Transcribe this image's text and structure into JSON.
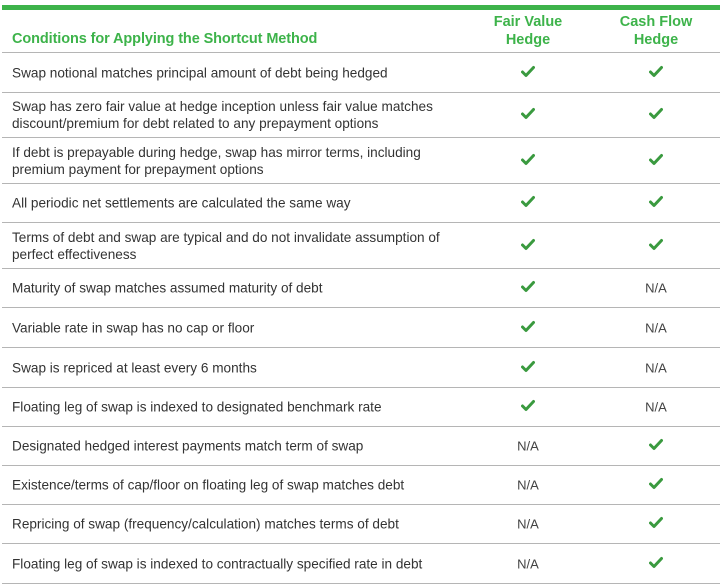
{
  "header": {
    "condition_label": "Conditions for Applying the Shortcut Method",
    "fair_value_label_line1": "Fair Value",
    "fair_value_label_line2": "Hedge",
    "cash_flow_label_line1": "Cash Flow",
    "cash_flow_label_line2": "Hedge"
  },
  "colors": {
    "accent": "#3db34a",
    "check": "#3a9a3f",
    "divider": "#b5b5b5"
  },
  "rows": [
    {
      "condition": "Swap notional matches principal amount of debt being hedged",
      "fair_value": "check",
      "cash_flow": "check"
    },
    {
      "condition": "Swap has zero fair value at hedge inception unless fair value matches discount/premium for debt related to any prepayment options",
      "fair_value": "check",
      "cash_flow": "check"
    },
    {
      "condition": "If debt is prepayable during hedge, swap has mirror terms, including premium payment for prepayment options",
      "fair_value": "check",
      "cash_flow": "check"
    },
    {
      "condition": "All periodic net settlements are calculated the same way",
      "fair_value": "check",
      "cash_flow": "check"
    },
    {
      "condition": "Terms of debt and swap are typical and do not invalidate assumption of perfect effectiveness",
      "fair_value": "check",
      "cash_flow": "check"
    },
    {
      "condition": "Maturity of swap matches assumed maturity of debt",
      "fair_value": "check",
      "cash_flow": "N/A"
    },
    {
      "condition": "Variable rate in swap has no cap or floor",
      "fair_value": "check",
      "cash_flow": "N/A"
    },
    {
      "condition": "Swap is repriced at least every 6 months",
      "fair_value": "check",
      "cash_flow": "N/A"
    },
    {
      "condition": "Floating leg of swap is indexed to designated benchmark rate",
      "fair_value": "check",
      "cash_flow": "N/A"
    },
    {
      "condition": "Designated hedged interest payments match term of swap",
      "fair_value": "N/A",
      "cash_flow": "check"
    },
    {
      "condition": "Existence/terms of cap/floor on floating leg of swap matches debt",
      "fair_value": "N/A",
      "cash_flow": "check"
    },
    {
      "condition": "Repricing of swap (frequency/calculation) matches terms of debt",
      "fair_value": "N/A",
      "cash_flow": "check"
    },
    {
      "condition": "Floating leg of swap is indexed to contractually specified rate in debt",
      "fair_value": "N/A",
      "cash_flow": "check"
    }
  ]
}
